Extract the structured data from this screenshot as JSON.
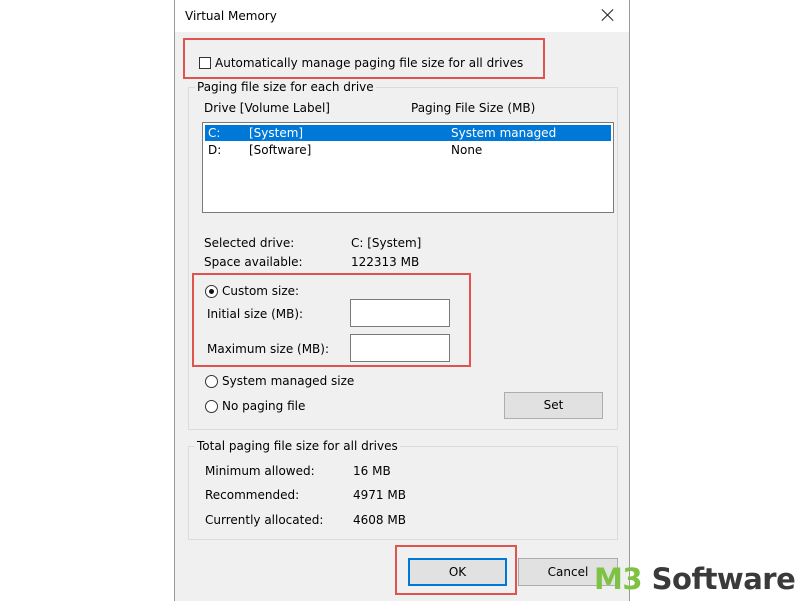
{
  "window": {
    "title": "Virtual Memory"
  },
  "auto_manage": {
    "label": "Automatically manage paging file size for all drives",
    "checked": false
  },
  "paging_group": {
    "title": "Paging file size for each drive",
    "col_drive": "Drive  [Volume Label]",
    "col_size": "Paging File Size (MB)",
    "drives": [
      {
        "drive": "C:",
        "label": "[System]",
        "size": "System managed",
        "selected": true
      },
      {
        "drive": "D:",
        "label": "[Software]",
        "size": "None",
        "selected": false
      }
    ]
  },
  "selected_drive": {
    "label": "Selected drive:",
    "value": "C:  [System]"
  },
  "space_available": {
    "label": "Space available:",
    "value": "122313 MB"
  },
  "options": {
    "custom_size": "Custom size:",
    "initial_size_label": "Initial size (MB):",
    "initial_size_value": "",
    "maximum_size_label": "Maximum size (MB):",
    "maximum_size_value": "",
    "system_managed": "System managed size",
    "no_paging": "No paging file",
    "selected": "custom_size",
    "set_button": "Set"
  },
  "totals": {
    "title": "Total paging file size for all drives",
    "min_label": "Minimum allowed:",
    "min_value": "16 MB",
    "rec_label": "Recommended:",
    "rec_value": "4971 MB",
    "cur_label": "Currently allocated:",
    "cur_value": "4608 MB"
  },
  "buttons": {
    "ok": "OK",
    "cancel": "Cancel"
  },
  "watermark": {
    "part1": "M3",
    "part2": " Software"
  },
  "colors": {
    "highlight": "#e0534f",
    "selection": "#0078d7",
    "logo_green": "#7dc242"
  }
}
